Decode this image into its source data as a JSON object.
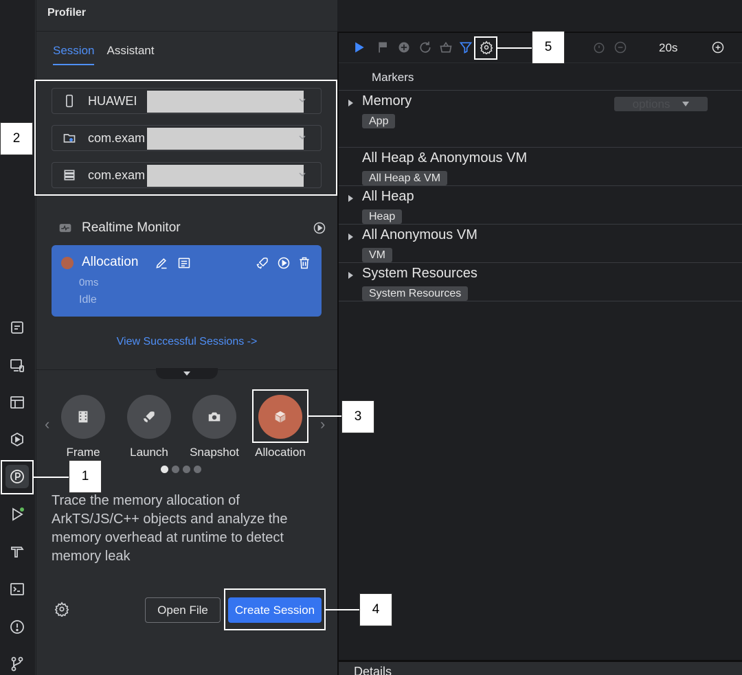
{
  "panel": {
    "title": "Profiler"
  },
  "tabs": [
    {
      "label": "Session"
    },
    {
      "label": "Assistant"
    }
  ],
  "selectors": {
    "device": "HUAWEI",
    "app": "com.exam",
    "process": "com.exam"
  },
  "realtime_monitor": {
    "label": "Realtime Monitor"
  },
  "session_card": {
    "name": "Allocation",
    "elapsed": "0ms",
    "state": "Idle"
  },
  "view_sessions_link": "View Successful Sessions ->",
  "session_types": [
    {
      "label": "Frame",
      "icon": "frame-icon"
    },
    {
      "label": "Launch",
      "icon": "rocket-icon"
    },
    {
      "label": "Snapshot",
      "icon": "camera-icon"
    },
    {
      "label": "Allocation",
      "icon": "cube-icon"
    }
  ],
  "description": "Trace the memory allocation of ArkTS/JS/C++ objects and analyze the memory overhead at runtime to detect memory leak",
  "buttons": {
    "open_file": "Open File",
    "create_session": "Create Session"
  },
  "timeline": {
    "zoom": "20s",
    "markers": "Markers",
    "options": "options",
    "rows": [
      {
        "title": "Memory",
        "tag": "App",
        "expandable": true
      },
      {
        "title": "All Heap & Anonymous VM",
        "tag": "All Heap & VM",
        "expandable": false
      },
      {
        "title": "All Heap",
        "tag": "Heap",
        "expandable": true
      },
      {
        "title": "All Anonymous VM",
        "tag": "VM",
        "expandable": true
      },
      {
        "title": "System Resources",
        "tag": "System Resources",
        "expandable": true
      }
    ],
    "details": "Details"
  },
  "callouts": [
    "1",
    "2",
    "3",
    "4",
    "5"
  ],
  "colors": {
    "accent": "#3574f0",
    "card": "#3b6bc6",
    "allocation": "#c0664d"
  }
}
